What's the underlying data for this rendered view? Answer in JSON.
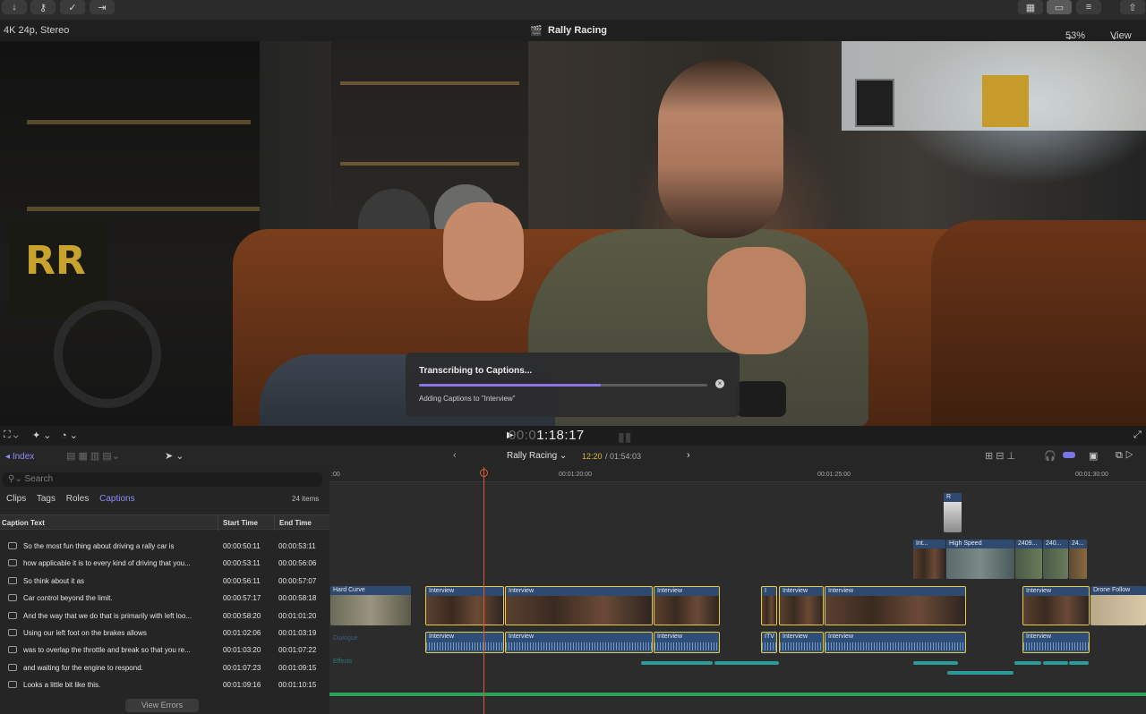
{
  "toolbar": {
    "left_buttons": [
      "↓",
      "⚷",
      "✓",
      "⇥"
    ],
    "right_buttons": [
      "▦",
      "▭",
      "≡",
      "⇧"
    ]
  },
  "viewer": {
    "format": "4K 24p, Stereo",
    "project_title": "Rally Racing",
    "zoom": "53%",
    "view_menu": "View"
  },
  "dialog": {
    "title": "Transcribing to Captions...",
    "status": "Adding Captions to \"Interview\"",
    "progress": 0.63
  },
  "transport": {
    "timecode_dim": "00:0",
    "timecode": "1:18:17"
  },
  "timeline_header": {
    "index_label": "Index",
    "project": "Rally Racing",
    "position": "12:20",
    "duration": "/ 01:54:03"
  },
  "index": {
    "search_placeholder": "Search",
    "tabs": [
      "Clips",
      "Tags",
      "Roles",
      "Captions"
    ],
    "selected_tab": "Captions",
    "item_count": "24 items",
    "columns": [
      "Caption Text",
      "Start Time",
      "End Time"
    ],
    "rows": [
      {
        "text": "So the most fun thing about driving a rally car is",
        "start": "00:00:50:11",
        "end": "00:00:53:11"
      },
      {
        "text": "how applicable it is to every kind of driving that you...",
        "start": "00:00:53:11",
        "end": "00:00:56:06"
      },
      {
        "text": "So think about it as",
        "start": "00:00:56:11",
        "end": "00:00:57:07"
      },
      {
        "text": "Car control beyond the limit.",
        "start": "00:00:57:17",
        "end": "00:00:58:18"
      },
      {
        "text": "And the way that we do that is primarily with left loo...",
        "start": "00:00:58:20",
        "end": "00:01:01:20"
      },
      {
        "text": "Using our left foot on the brakes allows",
        "start": "00:01:02:06",
        "end": "00:01:03:19"
      },
      {
        "text": "was to overlap the throttle and break so that you re...",
        "start": "00:01:03:20",
        "end": "00:01:07:22"
      },
      {
        "text": "and waiting for the engine to respond.",
        "start": "00:01:07:23",
        "end": "00:01:09:15"
      },
      {
        "text": "Looks a little bit like this.",
        "start": "00:01:09:16",
        "end": "00:01:10:15"
      }
    ],
    "view_errors": "View Errors"
  },
  "timeline": {
    "ticks": [
      ":00",
      "00:01:20:00",
      "00:01:25:00",
      "00:01:30:00"
    ],
    "lanes": {
      "dialogue": "Dialogue",
      "effects": "Effects"
    },
    "top_clips": [
      "R",
      "Int...",
      "High Speed",
      "2409...",
      "240...",
      "24..."
    ],
    "primary_clips": [
      "Hard Curve",
      "Interview",
      "Interview",
      "Interview",
      "I",
      "Interview",
      "Interview",
      "Interview",
      "Drone Follow"
    ],
    "audio_clips": [
      "Interview",
      "Interview",
      "Interview",
      "ITV",
      "Interview",
      "Interview",
      "Interview"
    ]
  },
  "colors": {
    "accent": "#8f8cf5",
    "selection": "#e9c941",
    "playhead": "#e05a2c",
    "effects": "#2a9a9a",
    "connected_storyline": "#2aa05a"
  }
}
